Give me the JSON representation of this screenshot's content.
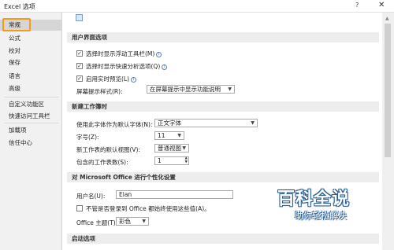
{
  "window": {
    "title": "Excel 选项",
    "help": "?",
    "close": "✕"
  },
  "sidebar": {
    "items": [
      {
        "label": "常规"
      },
      {
        "label": "公式"
      },
      {
        "label": "校对"
      },
      {
        "label": "保存"
      },
      {
        "label": "语言"
      },
      {
        "label": "高级"
      },
      {
        "label": "自定义功能区"
      },
      {
        "label": "快速访问工具栏"
      },
      {
        "label": "加载项"
      },
      {
        "label": "信任中心"
      }
    ],
    "active_index": 0,
    "highlight_color": "#f39a21"
  },
  "ui_options": {
    "header": "用户界面选项",
    "mini_toolbar": {
      "label": "选择时显示浮动工具栏(M)",
      "checked": true
    },
    "quick_analysis": {
      "label": "选择时显示快速分析选项(Q)",
      "checked": true
    },
    "live_preview": {
      "label": "启用实时预览(L)",
      "checked": true
    },
    "screentip_label": "屏幕提示样式(R):",
    "screentip_value": "在屏幕提示中显示功能说明"
  },
  "new_workbook": {
    "header": "新建工作簿时",
    "font_label": "使用此字体作为默认字体(N):",
    "font_value": "正文字体",
    "size_label": "字号(Z):",
    "size_value": "11",
    "view_label": "新工作表的默认视图(V):",
    "view_value": "普通视图",
    "sheets_label": "包含的工作表数(S):",
    "sheets_value": "1"
  },
  "personalize": {
    "header": "对 Microsoft Office 进行个性化设置",
    "username_label": "用户名(U):",
    "username_value": "Elan",
    "always_use_label": "不管是否登录到 Office 都始终使用这些值(A)。",
    "always_use_checked": false,
    "theme_label": "Office 主题(T):",
    "theme_value": "彩色"
  },
  "startup": {
    "header": "启动选项"
  },
  "watermark": {
    "brand": "百科全说",
    "tagline": "助你轻松解决"
  }
}
